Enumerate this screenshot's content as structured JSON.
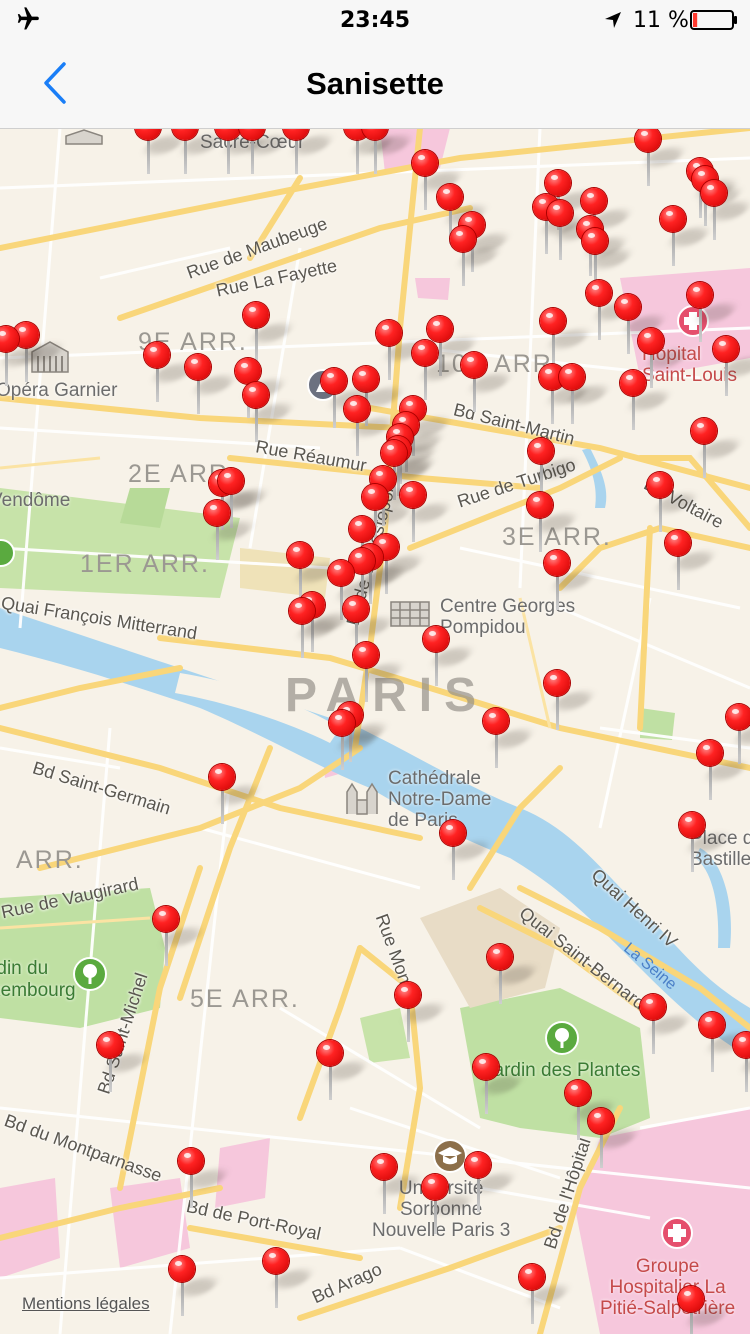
{
  "status_bar": {
    "time": "23:45",
    "battery_percent": "11 %",
    "battery_level": 0.11,
    "airplane_icon": "airplane-icon",
    "location_icon": "location-arrow-icon"
  },
  "nav": {
    "title": "Sanisette",
    "back_icon": "chevron-left-icon"
  },
  "colors": {
    "nav_tint": "#1a7ef7",
    "pin": "#ff2b2b",
    "water": "#a9d4ee",
    "park": "#bfe0a3",
    "hospital": "#f6c7dc",
    "land": "#f7f2e8",
    "road_major": "#f9d67a",
    "battery_low": "#ff3b30"
  },
  "map": {
    "districts": [
      {
        "key": "9e",
        "text": "9E ARR."
      },
      {
        "key": "10e",
        "text": "10E ARR."
      },
      {
        "key": "2e",
        "text": "2E ARR."
      },
      {
        "key": "1er",
        "text": "1ER ARR."
      },
      {
        "key": "3e",
        "text": "3E ARR."
      },
      {
        "key": "6e",
        "text": "ARR."
      },
      {
        "key": "5e",
        "text": "5E ARR."
      }
    ],
    "city_label": "PARIS",
    "streets": [
      {
        "key": "maubeuge",
        "text": "Rue de Maubeuge"
      },
      {
        "key": "lafayette",
        "text": "Rue La Fayette"
      },
      {
        "key": "stmartin",
        "text": "Bd Saint-Martin"
      },
      {
        "key": "reaumur",
        "text": "Rue Réaumur"
      },
      {
        "key": "turbigo",
        "text": "Rue de Turbigo"
      },
      {
        "key": "voltaire",
        "text": "Bd Voltaire"
      },
      {
        "key": "mitterrand",
        "text": "Quai François Mitterrand"
      },
      {
        "key": "sebastopol",
        "text": "Bd de Sébastopol"
      },
      {
        "key": "stgermain",
        "text": "Bd Saint-Germain"
      },
      {
        "key": "vaugirard",
        "text": "Rue de Vaugirard"
      },
      {
        "key": "henri",
        "text": "Quai Henri IV"
      },
      {
        "key": "stbernard",
        "text": "Quai Saint-Bernard"
      },
      {
        "key": "monge",
        "text": "Rue Monge"
      },
      {
        "key": "stmichel",
        "text": "Bd Saint-Michel"
      },
      {
        "key": "montparnasse",
        "text": "Bd du Montparnasse"
      },
      {
        "key": "portroyal",
        "text": "Bd de Port-Royal"
      },
      {
        "key": "arago",
        "text": "Bd Arago"
      },
      {
        "key": "hopital",
        "text": "Bd de l'Hôpital"
      }
    ],
    "river": "La Seine",
    "pois": [
      {
        "key": "sacrecoeur",
        "text": "Sacré-Cœur"
      },
      {
        "key": "garnier",
        "text": "Opéra Garnier"
      },
      {
        "key": "vendome",
        "text": "Vendôme"
      },
      {
        "key": "pompidou",
        "text": "Centre Georges\nPompidou"
      },
      {
        "key": "notredame",
        "text": "Cathédrale\nNotre-Dame\nde Paris"
      },
      {
        "key": "stlouis",
        "text": "Hôpital\nSaint-Louis"
      },
      {
        "key": "bastille",
        "text": "Place de la\nBastille"
      },
      {
        "key": "sorbonne",
        "text": "Université\nSorbonne\nNouvelle Paris 3"
      },
      {
        "key": "pitie",
        "text": "Groupe\nHospitalier La\nPitié-Salpêtrière"
      }
    ],
    "parks": [
      {
        "key": "luxembourg",
        "text": "Jardin du\nLuxembourg"
      },
      {
        "key": "plantes",
        "text": "Jardin des Plantes"
      }
    ],
    "legal_link": "Mentions légales",
    "pin_count": 100
  }
}
